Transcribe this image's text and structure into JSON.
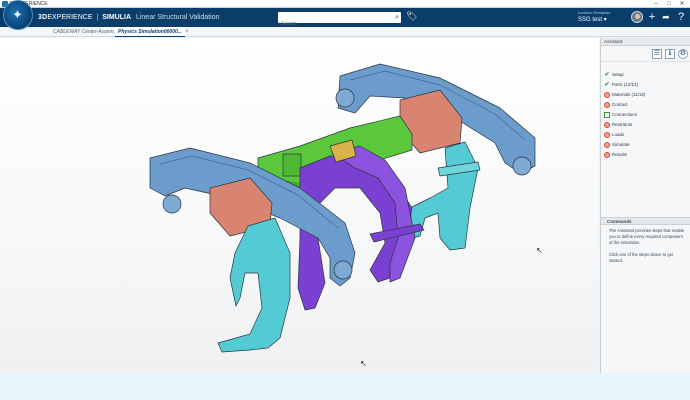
{
  "os": {
    "title": "3DEXPERIENCE",
    "minimize": "–",
    "maximize": "□",
    "close": "✕"
  },
  "topbar": {
    "brand_3d": "3D",
    "brand_experience": "EXPERIENCE",
    "separator": "|",
    "brand_app": "SIMULIA",
    "brand_subtitle": "Linear Structural Validation",
    "search_placeholder": "Search",
    "user_line1": "Lorenzo Pomposo",
    "user_line2": "SSG test ▾",
    "add_icon": "+",
    "share_icon": "➦",
    "help_icon": "?"
  },
  "tabs": [
    {
      "label": "CABLEWAY Center-Assem..."
    },
    {
      "label": "Physics Simulation00000..."
    }
  ],
  "tab_close": "×",
  "panel": {
    "title": "Assistant",
    "tools": [
      {
        "icon": "list-view-icon",
        "glyph": "☰"
      },
      {
        "icon": "info-icon",
        "glyph": "ℹ"
      },
      {
        "icon": "settings-icon",
        "glyph": "⚙"
      }
    ],
    "steps": [
      {
        "label": "Setup",
        "status": "done"
      },
      {
        "label": "Parts (12/12)",
        "status": "done"
      },
      {
        "label": "Materials (11/12)",
        "status": "warning"
      },
      {
        "label": "Contact",
        "status": "warning"
      },
      {
        "label": "Connections",
        "status": "empty"
      },
      {
        "label": "Restraints",
        "status": "warning"
      },
      {
        "label": "Loads",
        "status": "warning"
      },
      {
        "label": "Simulate",
        "status": "warning"
      },
      {
        "label": "Results",
        "status": "warning"
      }
    ],
    "commands_title": "Commands",
    "commands_text": [
      "The Assistant provides steps that enable you to define every required component of the simulation.",
      "Click one of the steps above to get started."
    ]
  },
  "colors": {
    "topbar": "#0a3d69",
    "blue_part": "#5f8fbf",
    "cyan_part": "#4fc9d2",
    "purple_part": "#7a3fd0",
    "green_part": "#58c33a",
    "salmon_part": "#d98070"
  }
}
